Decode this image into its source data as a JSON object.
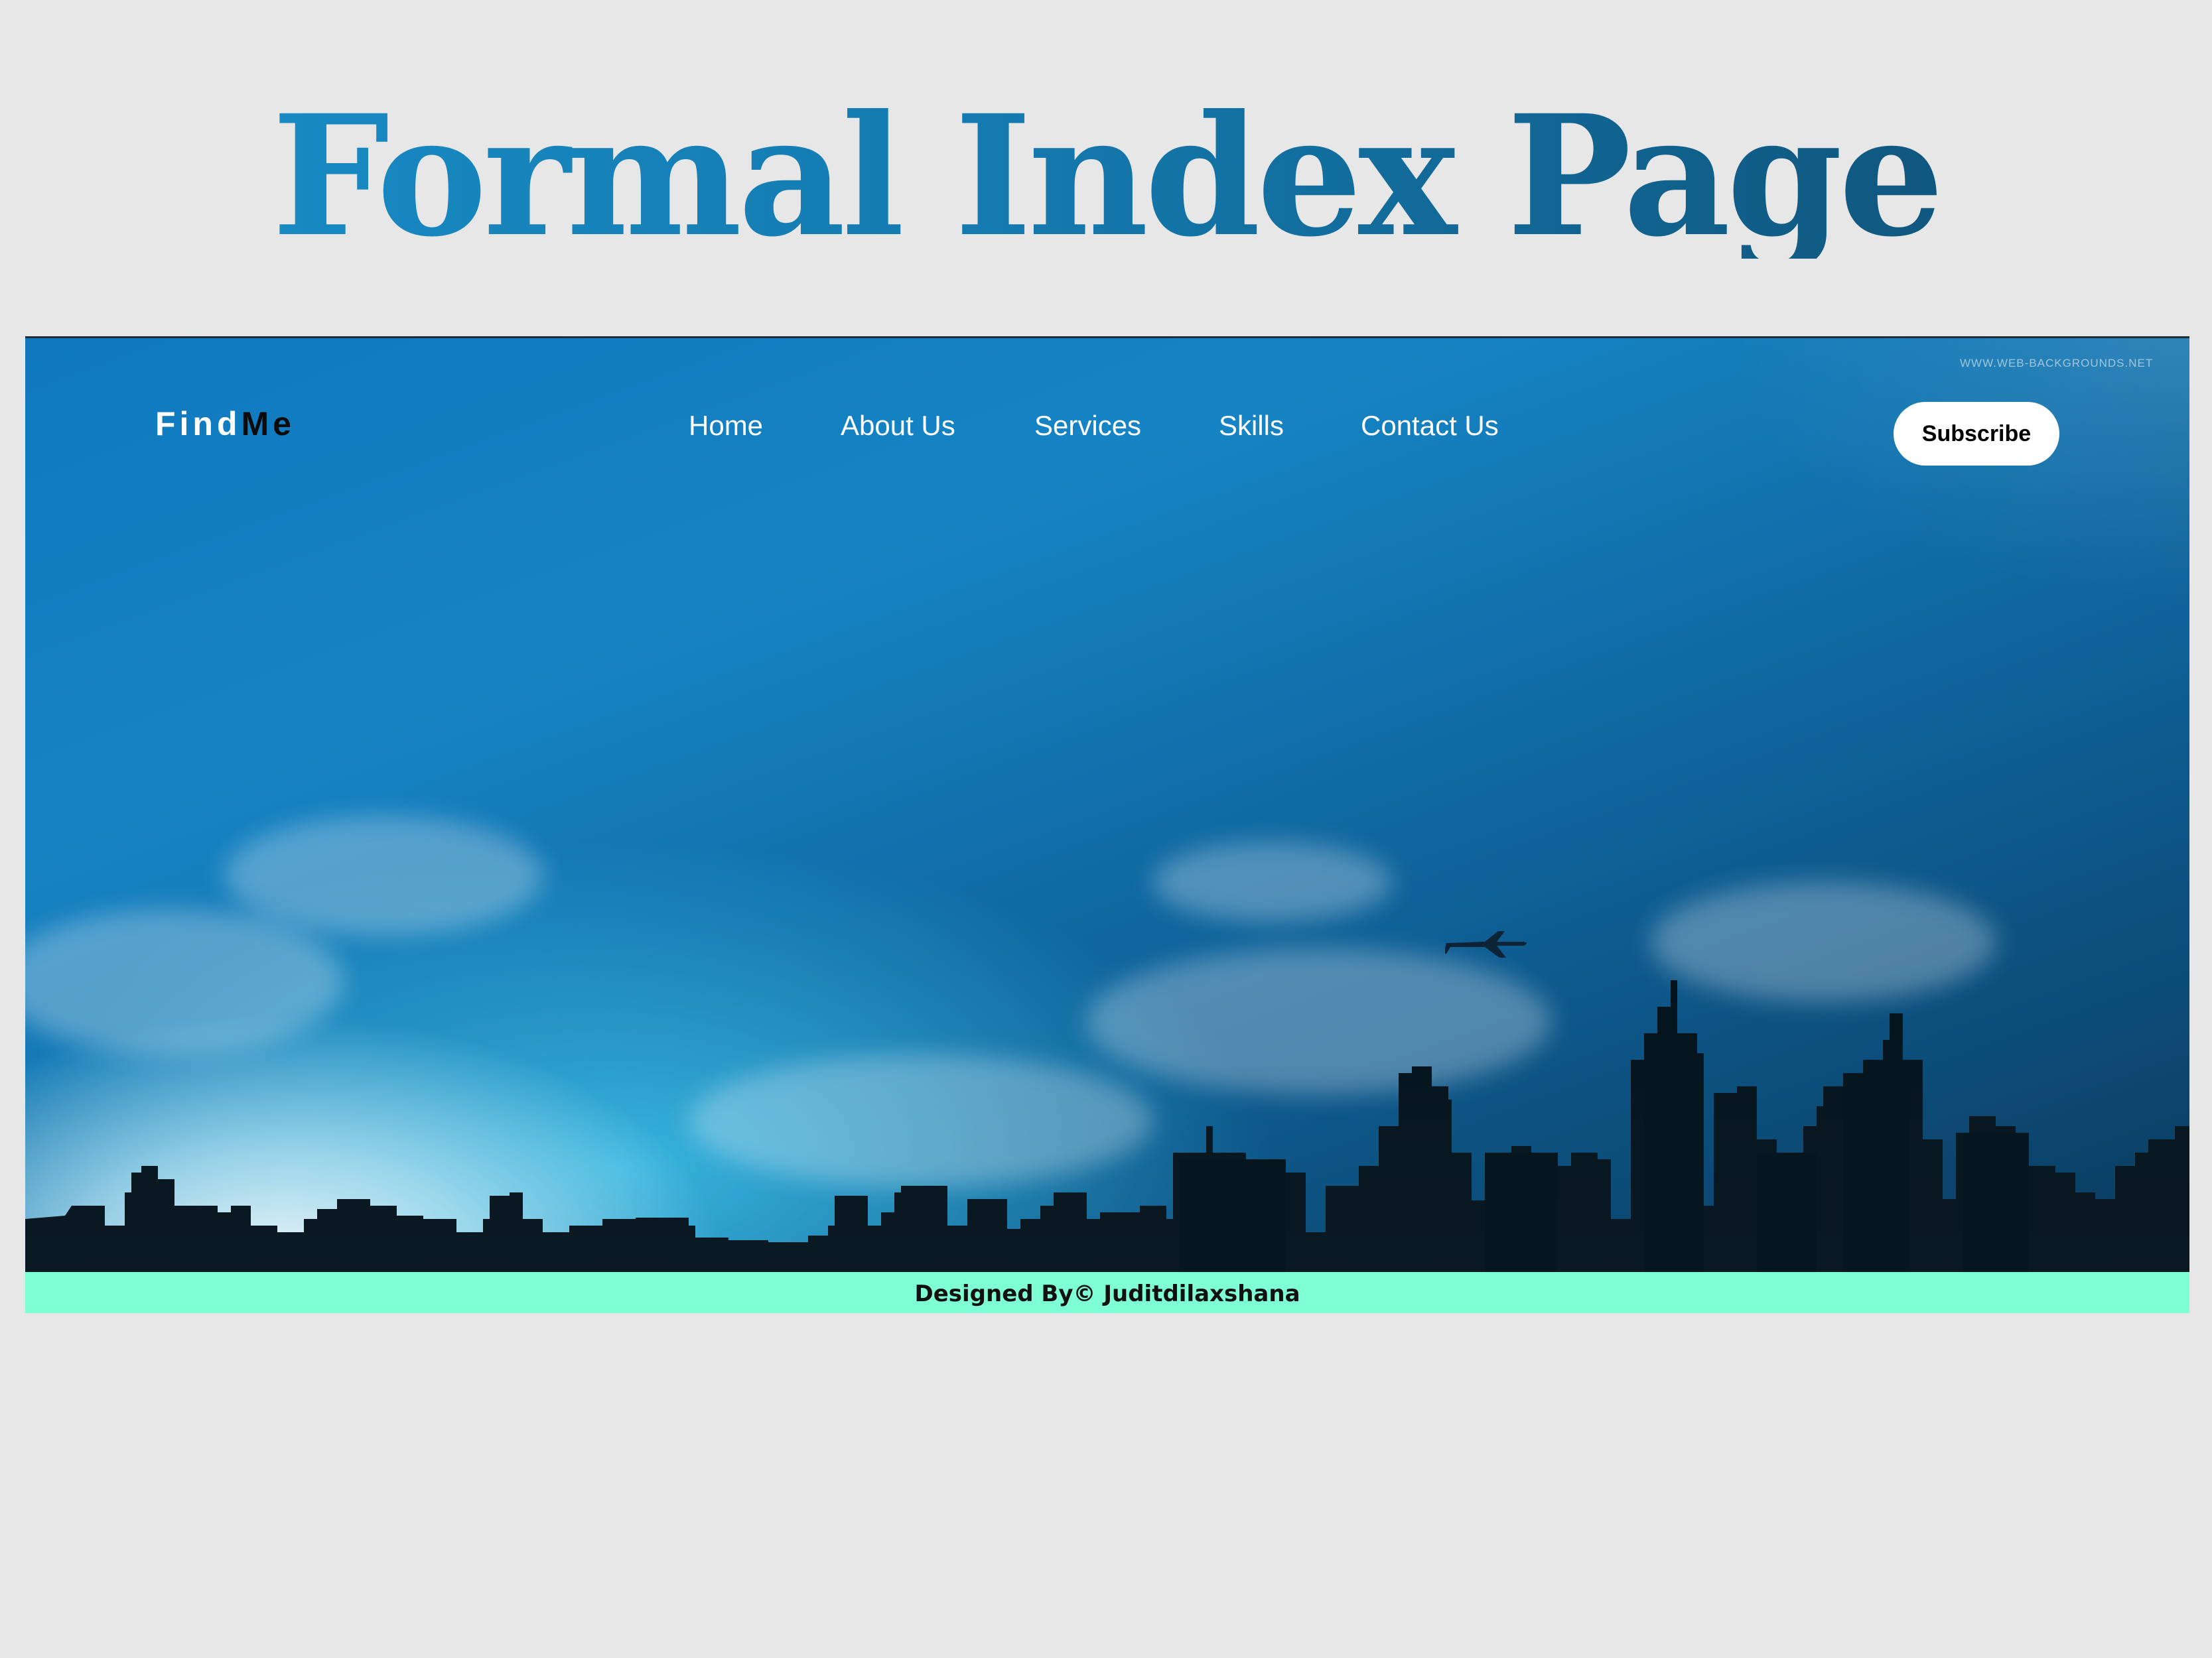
{
  "title": "Formal Index Page",
  "header": {
    "logo_part1": "Find",
    "logo_part2": "Me",
    "nav": [
      "Home",
      "About Us",
      "Services",
      "Skills",
      "Contact Us"
    ],
    "subscribe_label": "Subscribe",
    "watermark": "WWW.WEB-BACKGROUNDS.NET"
  },
  "footer": {
    "text": "Designed By© Juditdilaxshana"
  },
  "colors": {
    "background": "#e7e7e7",
    "title_gradient_start": "#1a8fc9",
    "title_gradient_end": "#0e4d71",
    "footer_bg": "#7fffd4",
    "sky_top": "#0f78bd",
    "sky_dark": "#0a3a5c"
  },
  "icons": [
    "airplane-icon",
    "city-skyline"
  ]
}
